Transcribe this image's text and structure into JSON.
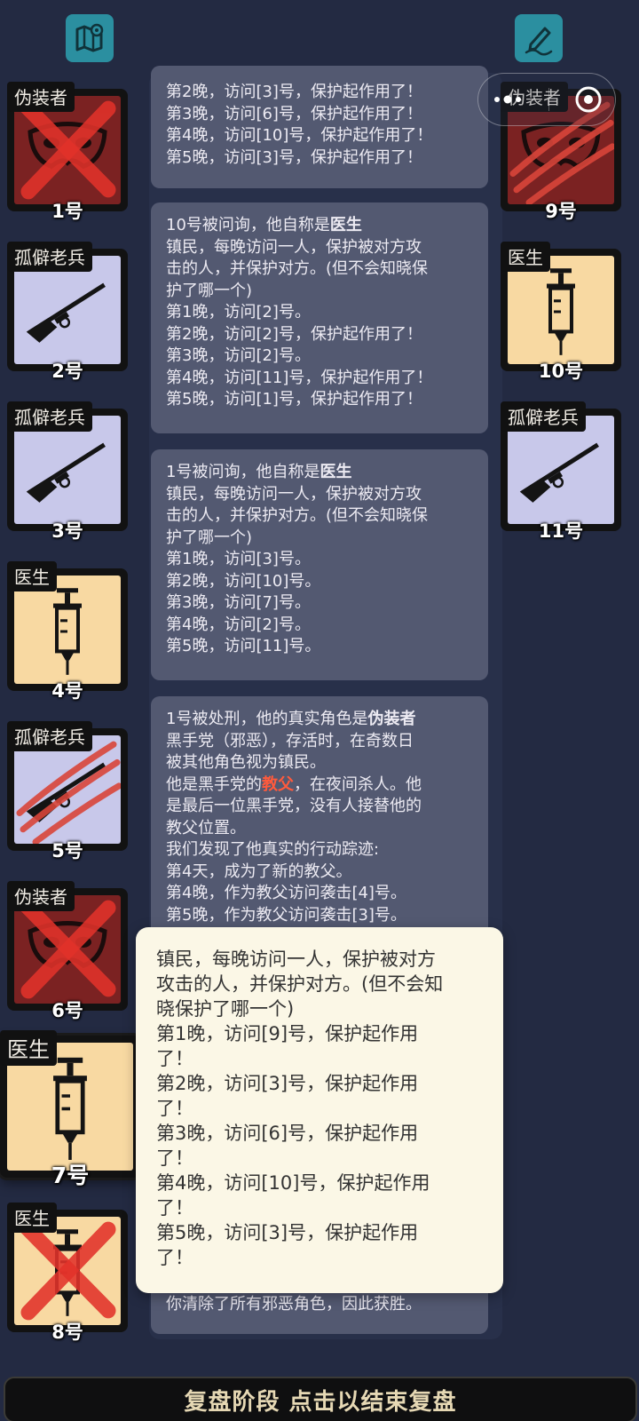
{
  "colors": {
    "background": "#232a42",
    "accent_icon": "#2b8fa0",
    "disguiser_card": "#7b2222",
    "veteran_card": "#c8c8ea",
    "doctor_card": "#f8d9a2",
    "highlight_red": "#ff5a3c",
    "popup_bg": "#fbf7e6"
  },
  "top_bar": {
    "left_icon": "map-pin-icon",
    "right_icon": "notebook-pen-icon",
    "capsule_icons": [
      "more-dots-icon",
      "close-target-icon"
    ]
  },
  "players": [
    {
      "number": "1号",
      "role": "伪装者",
      "state": "crossed",
      "art": "mask-icon"
    },
    {
      "number": "2号",
      "role": "孤僻老兵",
      "state": "alive",
      "art": "rifle-icon"
    },
    {
      "number": "3号",
      "role": "孤僻老兵",
      "state": "alive",
      "art": "rifle-icon"
    },
    {
      "number": "4号",
      "role": "医生",
      "state": "alive",
      "art": "syringe-icon"
    },
    {
      "number": "5号",
      "role": "孤僻老兵",
      "state": "clawed",
      "art": "rifle-icon"
    },
    {
      "number": "6号",
      "role": "伪装者",
      "state": "crossed",
      "art": "mask-icon"
    },
    {
      "number": "7号",
      "role": "医生",
      "state": "selected",
      "art": "syringe-icon"
    },
    {
      "number": "8号",
      "role": "医生",
      "state": "crossed",
      "art": "syringe-icon"
    },
    {
      "number": "9号",
      "role": "伪装者",
      "state": "clawed",
      "art": "mask-icon"
    },
    {
      "number": "10号",
      "role": "医生",
      "state": "alive",
      "art": "syringe-icon"
    },
    {
      "number": "11号",
      "role": "孤僻老兵",
      "state": "alive",
      "art": "rifle-icon"
    }
  ],
  "logs": [
    {
      "lines": [
        "第2晚，访问[3]号，保护起作用了！",
        "第3晚，访问[6]号，保护起作用了！",
        "第4晚，访问[10]号，保护起作用了！",
        "第5晚，访问[3]号，保护起作用了！"
      ]
    },
    {
      "head": "10号被问询，他自称是",
      "head_role": "医生",
      "lines": [
        "镇民，每晚访问一人，保护被对方攻",
        "击的人，并保护对方。(但不会知晓保",
        "护了哪一个)",
        "第1晚，访问[2]号。",
        "第2晚，访问[2]号，保护起作用了！",
        "第3晚，访问[2]号。",
        "第4晚，访问[11]号，保护起作用了！",
        "第5晚，访问[1]号，保护起作用了！"
      ]
    },
    {
      "head": "1号被问询，他自称是",
      "head_role": "医生",
      "lines": [
        "镇民，每晚访问一人，保护被对方攻",
        "击的人，并保护对方。(但不会知晓保",
        "护了哪一个)",
        "第1晚，访问[3]号。",
        "第2晚，访问[10]号。",
        "第3晚，访问[7]号。",
        "第4晚，访问[2]号。",
        "第5晚，访问[11]号。"
      ]
    },
    {
      "head": "1号被处刑，他的真实角色是",
      "head_role": "伪装者",
      "line1": "黑手党（邪恶），存活时，在奇数日",
      "line2": "被其他角色视为镇民。",
      "line3_pre": "他是黑手党的",
      "line3_red": "教父",
      "line3_post": "，在夜间杀人。他",
      "line4": "是最后一位黑手党，没有人接替他的",
      "line5": "教父位置。",
      "line6": "我们发现了他真实的行动踪迹:",
      "line7": "第4天，成为了新的教父。",
      "line8": "第4晚，作为教父访问袭击[4]号。",
      "line9": "第5晚，作为教父访问袭击[3]号。",
      "footer": "你清除了所有邪恶角色，因此获胜。"
    }
  ],
  "popup": {
    "lines": [
      "镇民，每晚访问一人，保护被对方",
      "攻击的人，并保护对方。(但不会知",
      "晓保护了哪一个)",
      "第1晚，访问[9]号，保护起作用",
      "了！",
      "第2晚，访问[3]号，保护起作用",
      "了！",
      "第3晚，访问[6]号，保护起作用",
      "了！",
      "第4晚，访问[10]号，保护起作用",
      "了！",
      "第5晚，访问[3]号，保护起作用",
      "了！"
    ]
  },
  "bottom_bar": {
    "label": "复盘阶段 点击以结束复盘"
  }
}
